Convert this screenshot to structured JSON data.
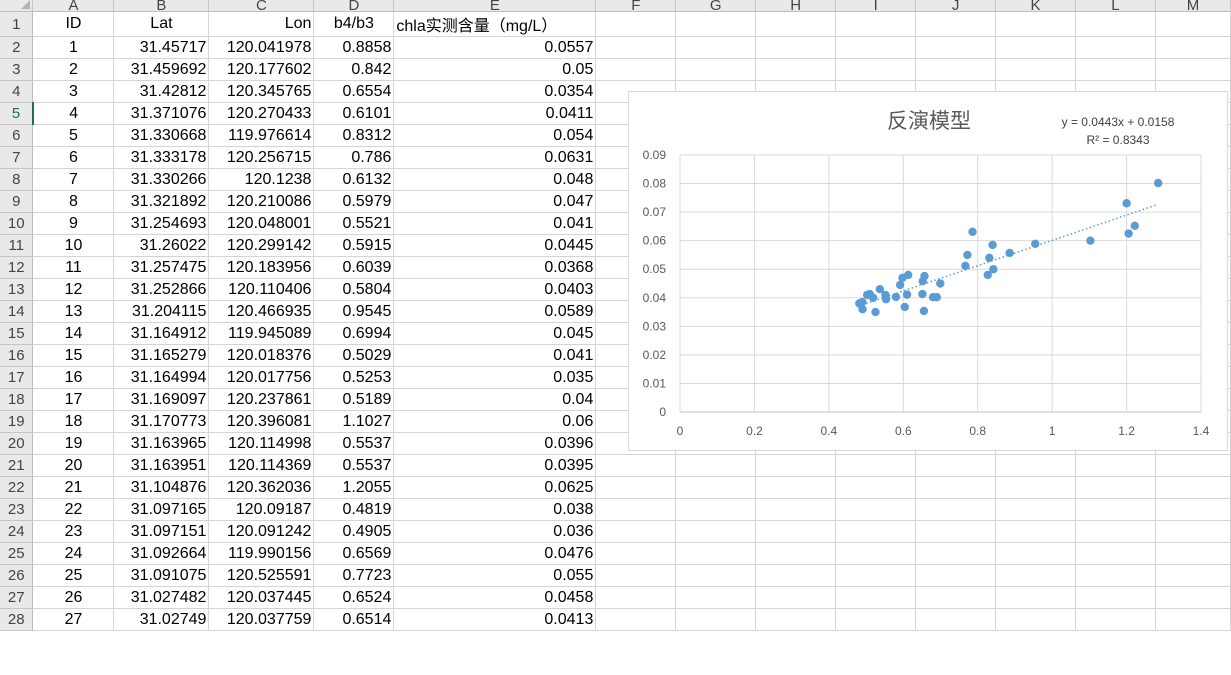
{
  "columns": [
    "A",
    "B",
    "C",
    "D",
    "E",
    "F",
    "G",
    "H",
    "I",
    "J",
    "K",
    "L",
    "M"
  ],
  "header_row": [
    "ID",
    "Lat",
    "Lon",
    "b4/b3",
    "chla实测含量（mg/L）"
  ],
  "selected_row": 5,
  "rows": [
    [
      "1",
      "31.45717",
      "120.041978",
      "0.8858",
      "0.0557"
    ],
    [
      "2",
      "31.459692",
      "120.177602",
      "0.842",
      "0.05"
    ],
    [
      "3",
      "31.42812",
      "120.345765",
      "0.6554",
      "0.0354"
    ],
    [
      "4",
      "31.371076",
      "120.270433",
      "0.6101",
      "0.0411"
    ],
    [
      "5",
      "31.330668",
      "119.976614",
      "0.8312",
      "0.054"
    ],
    [
      "6",
      "31.333178",
      "120.256715",
      "0.786",
      "0.0631"
    ],
    [
      "7",
      "31.330266",
      "120.1238",
      "0.6132",
      "0.048"
    ],
    [
      "8",
      "31.321892",
      "120.210086",
      "0.5979",
      "0.047"
    ],
    [
      "9",
      "31.254693",
      "120.048001",
      "0.5521",
      "0.041"
    ],
    [
      "10",
      "31.26022",
      "120.299142",
      "0.5915",
      "0.0445"
    ],
    [
      "11",
      "31.257475",
      "120.183956",
      "0.6039",
      "0.0368"
    ],
    [
      "12",
      "31.252866",
      "120.110406",
      "0.5804",
      "0.0403"
    ],
    [
      "13",
      "31.204115",
      "120.466935",
      "0.9545",
      "0.0589"
    ],
    [
      "14",
      "31.164912",
      "119.945089",
      "0.6994",
      "0.045"
    ],
    [
      "15",
      "31.165279",
      "120.018376",
      "0.5029",
      "0.041"
    ],
    [
      "16",
      "31.164994",
      "120.017756",
      "0.5253",
      "0.035"
    ],
    [
      "17",
      "31.169097",
      "120.237861",
      "0.5189",
      "0.04"
    ],
    [
      "18",
      "31.170773",
      "120.396081",
      "1.1027",
      "0.06"
    ],
    [
      "19",
      "31.163965",
      "120.114998",
      "0.5537",
      "0.0396"
    ],
    [
      "20",
      "31.163951",
      "120.114369",
      "0.5537",
      "0.0395"
    ],
    [
      "21",
      "31.104876",
      "120.362036",
      "1.2055",
      "0.0625"
    ],
    [
      "22",
      "31.097165",
      "120.09187",
      "0.4819",
      "0.038"
    ],
    [
      "23",
      "31.097151",
      "120.091242",
      "0.4905",
      "0.036"
    ],
    [
      "24",
      "31.092664",
      "119.990156",
      "0.6569",
      "0.0476"
    ],
    [
      "25",
      "31.091075",
      "120.525591",
      "0.7723",
      "0.055"
    ],
    [
      "26",
      "31.027482",
      "120.037445",
      "0.6524",
      "0.0458"
    ],
    [
      "27",
      "31.02749",
      "120.037759",
      "0.6514",
      "0.0413"
    ]
  ],
  "chart": {
    "title": "反演模型",
    "equation": "y = 0.0443x + 0.0158",
    "r2": "R² = 0.8343",
    "point_color": "#5b9bd5",
    "trend_color": "#5b9bd5"
  },
  "chart_data": {
    "type": "scatter",
    "title": "反演模型",
    "xlim": [
      0,
      1.4
    ],
    "ylim": [
      0,
      0.09
    ],
    "x_ticks": [
      "0",
      "0.2",
      "0.4",
      "0.6",
      "0.8",
      "1",
      "1.2",
      "1.4"
    ],
    "y_ticks": [
      "0",
      "0.01",
      "0.02",
      "0.03",
      "0.04",
      "0.05",
      "0.06",
      "0.07",
      "0.08",
      "0.09"
    ],
    "grid": true,
    "trendline": {
      "slope": 0.0443,
      "intercept": 0.0158,
      "x_range": [
        0.48,
        1.28
      ],
      "style": "dotted"
    },
    "points": [
      [
        0.8858,
        0.0557
      ],
      [
        0.842,
        0.05
      ],
      [
        0.6554,
        0.0354
      ],
      [
        0.6101,
        0.0411
      ],
      [
        0.8312,
        0.054
      ],
      [
        0.786,
        0.0631
      ],
      [
        0.6132,
        0.048
      ],
      [
        0.5979,
        0.047
      ],
      [
        0.5521,
        0.041
      ],
      [
        0.5915,
        0.0445
      ],
      [
        0.6039,
        0.0368
      ],
      [
        0.5804,
        0.0403
      ],
      [
        0.9545,
        0.0589
      ],
      [
        0.6994,
        0.045
      ],
      [
        0.5029,
        0.041
      ],
      [
        0.5253,
        0.035
      ],
      [
        0.5189,
        0.04
      ],
      [
        1.1027,
        0.06
      ],
      [
        0.5537,
        0.0396
      ],
      [
        0.5537,
        0.0395
      ],
      [
        1.2055,
        0.0625
      ],
      [
        0.4819,
        0.038
      ],
      [
        0.4905,
        0.036
      ],
      [
        0.6569,
        0.0476
      ],
      [
        0.7723,
        0.055
      ],
      [
        0.6524,
        0.0458
      ],
      [
        0.6514,
        0.0413
      ],
      [
        1.2,
        0.0731
      ],
      [
        1.285,
        0.0802
      ],
      [
        1.222,
        0.0652
      ],
      [
        0.84,
        0.0585
      ],
      [
        0.767,
        0.0512
      ],
      [
        0.68,
        0.0402
      ],
      [
        0.69,
        0.0402
      ],
      [
        0.827,
        0.048
      ],
      [
        0.537,
        0.043
      ],
      [
        0.49,
        0.0385
      ],
      [
        0.51,
        0.0413
      ]
    ]
  }
}
